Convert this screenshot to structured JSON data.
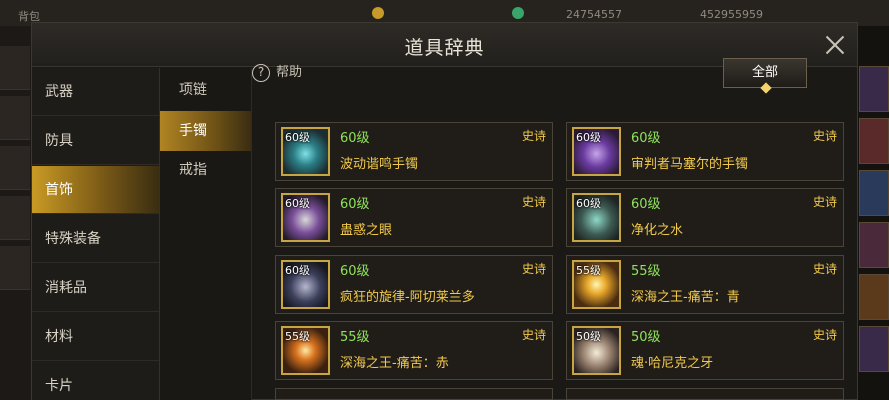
{
  "hud": {
    "left_label": "背包",
    "currency1": "24754557",
    "currency2": "452955959"
  },
  "dialog": {
    "title": "道具辞典"
  },
  "categories": [
    {
      "label": "武器"
    },
    {
      "label": "防具"
    },
    {
      "label": "首饰"
    },
    {
      "label": "特殊装备"
    },
    {
      "label": "消耗品"
    },
    {
      "label": "材料"
    },
    {
      "label": "卡片"
    }
  ],
  "active_category": "首饰",
  "subcategories": [
    {
      "label": "项链"
    },
    {
      "label": "手镯"
    },
    {
      "label": "戒指"
    }
  ],
  "active_subcategory": "手镯",
  "help_label": "帮助",
  "filter_label": "全部",
  "items": [
    {
      "badge": "60级",
      "level": "60级",
      "rarity": "史诗",
      "name": "波动谐鸣手镯",
      "icon": "teal-bracelet-icon"
    },
    {
      "badge": "60级",
      "level": "60级",
      "rarity": "史诗",
      "name": "审判者马塞尔的手镯",
      "icon": "purple-bracelet-icon"
    },
    {
      "badge": "60级",
      "level": "60级",
      "rarity": "史诗",
      "name": "蛊惑之眼",
      "icon": "eye-bracelet-icon"
    },
    {
      "badge": "60级",
      "level": "60级",
      "rarity": "史诗",
      "name": "净化之水",
      "icon": "water-bracelet-icon"
    },
    {
      "badge": "60级",
      "level": "60级",
      "rarity": "史诗",
      "name": "疯狂的旋律-阿切莱兰多",
      "icon": "melody-bracelet-icon"
    },
    {
      "badge": "55级",
      "level": "55级",
      "rarity": "史诗",
      "name": "深海之王-痛苦：青",
      "icon": "sea-king-blue-icon"
    },
    {
      "badge": "55级",
      "level": "55级",
      "rarity": "史诗",
      "name": "深海之王-痛苦：赤",
      "icon": "sea-king-red-icon"
    },
    {
      "badge": "50级",
      "level": "50级",
      "rarity": "史诗",
      "name": "魂·哈尼克之牙",
      "icon": "fang-bracelet-icon"
    }
  ],
  "colors": {
    "level_text": "#8fe25a",
    "rarity_text": "#f2c94a",
    "name_text": "#f2c94a",
    "active_tab": "#c99a24"
  }
}
